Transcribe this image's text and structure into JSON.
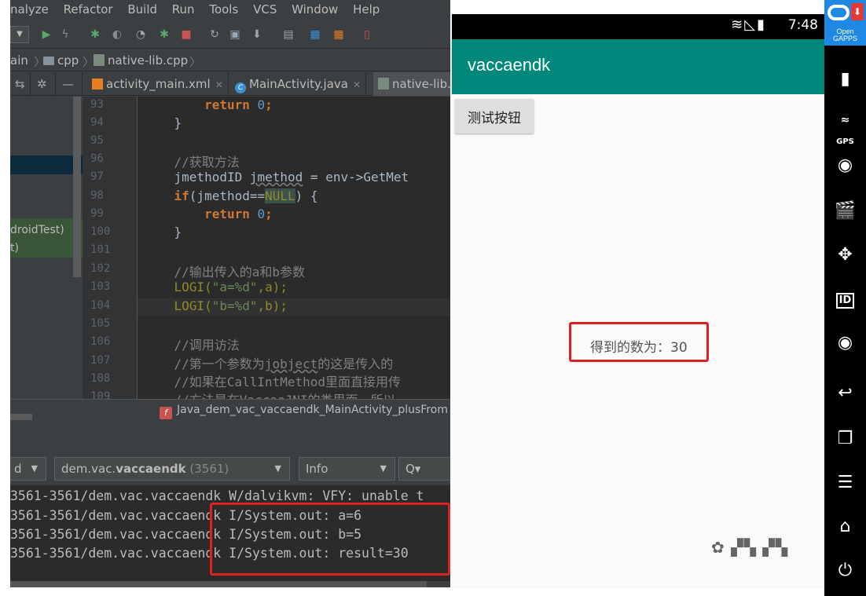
{
  "ide": {
    "menu": [
      "nalyze",
      "Refactor",
      "Build",
      "Run",
      "Tools",
      "VCS",
      "Window",
      "Help"
    ],
    "breadcrumb": {
      "part1": "ain",
      "part2": "cpp",
      "file": "native-lib.cpp"
    },
    "tabs": [
      {
        "label": "activity_main.xml"
      },
      {
        "label": "MainActivity.java"
      },
      {
        "label": "native-lib."
      }
    ],
    "project_panel": {
      "item1": "droidTest)",
      "item2": "t)"
    },
    "line_numbers": [
      "93",
      "94",
      "95",
      "96",
      "97",
      "98",
      "99",
      "100",
      "101",
      "102",
      "103",
      "104",
      "105",
      "106",
      "107",
      "108",
      "109"
    ],
    "code": {
      "l93": [
        "        ",
        "return",
        " ",
        "0",
        ";"
      ],
      "l94": "    }",
      "l96": "    //获取方法",
      "l97": [
        "    jmethodID ",
        "jmethod",
        " = env->GetMet"
      ],
      "l98": [
        "    ",
        "if",
        "(jmethod==",
        "NULL",
        ") {"
      ],
      "l99": [
        "        ",
        "return",
        " ",
        "0",
        ";"
      ],
      "l100": "    }",
      "l102": "    //输出传入的a和b参数",
      "l103": [
        "    ",
        "LOGI",
        "(",
        "\"a=%d\"",
        ",a);"
      ],
      "l104": [
        "    ",
        "LOGI",
        "(",
        "\"b=%d\"",
        ",b);"
      ],
      "l106": "    //调用访法",
      "l107": [
        "    //第一个参数为",
        "jobject",
        "的这是传入的"
      ],
      "l108": [
        "    //如果在",
        "CallIntMethod",
        "里面直接用传"
      ],
      "l109": "    //方法是在VaccaeJNI的类里面，所以"
    },
    "function_bar": {
      "badge": "f",
      "label": "Java_dem_vac_vaccaendk_MainActivity_plusFrom"
    },
    "logcat": {
      "device_filter": "d",
      "process_filter": {
        "prefix": "dem.vac.",
        "bold": "vaccaendk",
        "pid": "(3561)"
      },
      "level": "Info",
      "search_icon": "Q▾",
      "lines": [
        "3561-3561/dem.vac.vaccaendk W/dalvikvm: VFY: unable t",
        "3561-3561/dem.vac.vaccaendk I/System.out: a=6",
        "3561-3561/dem.vac.vaccaendk I/System.out: b=5",
        "3561-3561/dem.vac.vaccaendk I/System.out: result=30"
      ]
    }
  },
  "emulator": {
    "status_time": "7:48",
    "app_title": "vaccaendk",
    "test_button": "测试按钮",
    "result_text": "得到的数为：30",
    "sidebar": {
      "logo_text_1": "Open",
      "logo_text_2": "GAPPS",
      "gps_label": "GPS",
      "id_label": "ID"
    }
  },
  "colors": {
    "ide_bg": "#3c3f41",
    "editor_bg": "#2b2b2b",
    "keyword": "#cc7832",
    "number": "#6897bb",
    "comment": "#808080",
    "string": "#6a8759",
    "app_bar": "#00897b",
    "highlight_box": "#e02020"
  }
}
